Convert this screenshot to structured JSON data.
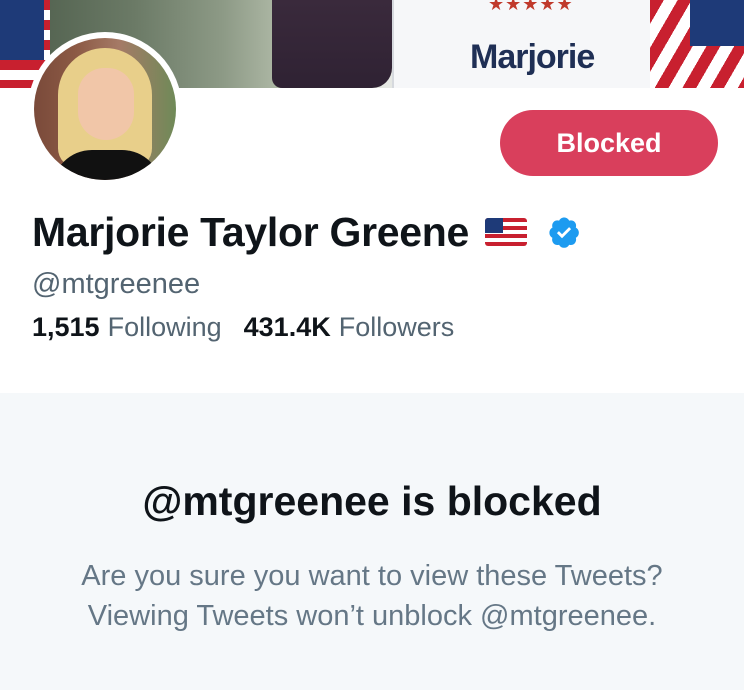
{
  "banner": {
    "sign_text": "Marjorie",
    "stars": "★★★★★"
  },
  "header": {
    "blocked_label": "Blocked"
  },
  "profile": {
    "name": "Marjorie Taylor Greene",
    "handle": "@mtgreenee",
    "following_count": "1,515",
    "following_label": "Following",
    "followers_count": "431.4K",
    "followers_label": "Followers",
    "verified_color": "#1d9bf0"
  },
  "blocked_notice": {
    "title": "@mtgreenee is blocked",
    "description": "Are you sure you want to view these Tweets? Viewing Tweets won’t unblock @mtgreenee."
  },
  "colors": {
    "blocked_button": "#d93f5c",
    "panel_bg": "#f5f8fa"
  },
  "icons": [
    "us-flag-icon",
    "verified-badge-icon"
  ]
}
